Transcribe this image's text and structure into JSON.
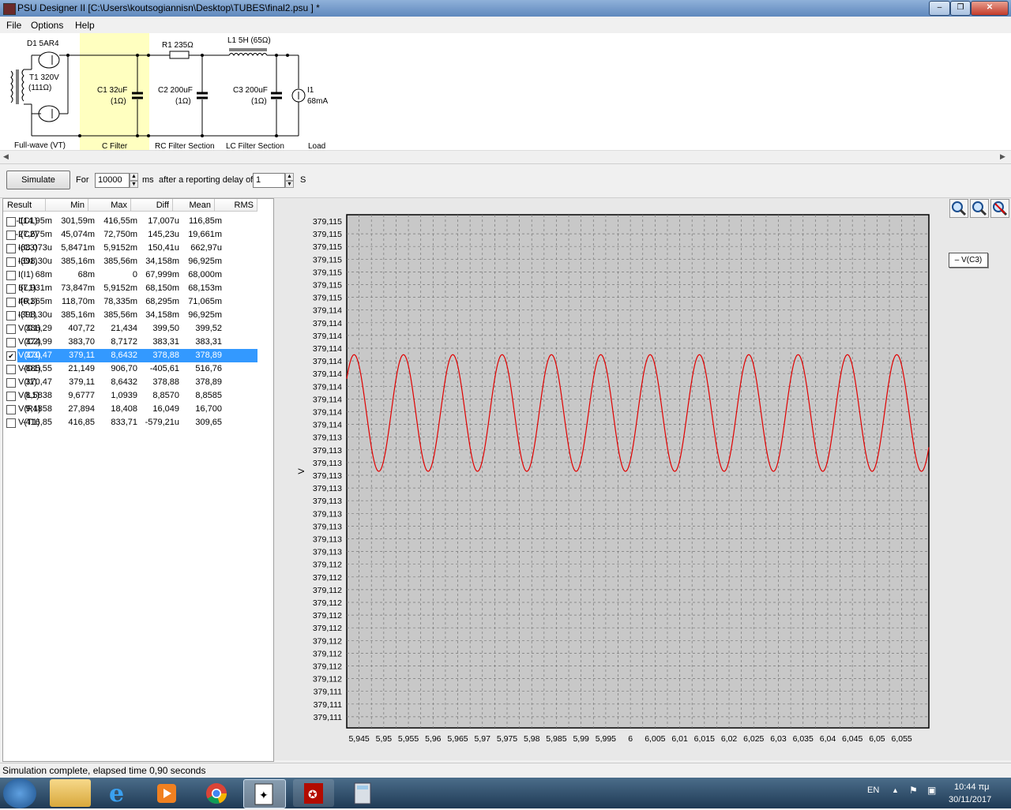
{
  "window": {
    "title": "PSU Designer II  [C:\\Users\\koutsogiannisn\\Desktop\\TUBES\\final2.psu ] *",
    "minimize": "–",
    "maximize": "❐",
    "close": "✕"
  },
  "menu": [
    "File",
    "Options",
    "Help"
  ],
  "schematic": {
    "d1": "D1 5AR4",
    "t1": "T1 320V",
    "t1r": "(111Ω)",
    "c1": "C1 32uF",
    "c1r": "(1Ω)",
    "r1": "R1 235Ω",
    "c2": "C2 200uF",
    "c2r": "(1Ω)",
    "l1": "L1 5H (65Ω)",
    "c3": "C3 200uF",
    "c3r": "(1Ω)",
    "i1": "I1",
    "i1v": "68mA",
    "sections": [
      "Full-wave (VT)",
      "C Filter",
      "RC Filter Section",
      "LC Filter Section",
      "Load"
    ]
  },
  "sim": {
    "button": "Simulate",
    "for_label": "For",
    "duration": "10000",
    "ms_label": "ms",
    "delay_label": "after a reporting delay of",
    "delay": "1",
    "s_label": "S"
  },
  "results": {
    "headers": [
      "Result",
      "Min",
      "Max",
      "Diff",
      "Mean",
      "RMS"
    ],
    "rows": [
      {
        "name": "I(C1)",
        "min": "-114,95m",
        "max": "301,59m",
        "diff": "416,55m",
        "mean": "17,007u",
        "rms": "116,85m",
        "checked": false,
        "selected": false
      },
      {
        "name": "I(C2)",
        "min": "-27,675m",
        "max": "45,074m",
        "diff": "72,750m",
        "mean": "145,23u",
        "rms": "19,661m",
        "checked": false,
        "selected": false
      },
      {
        "name": "I(C3)",
        "min": "-68,073u",
        "max": "5,8471m",
        "diff": "5,9152m",
        "mean": "150,41u",
        "rms": "662,97u",
        "checked": false,
        "selected": false
      },
      {
        "name": "I(D1)",
        "min": "-398,30u",
        "max": "385,16m",
        "diff": "385,56m",
        "mean": "34,158m",
        "rms": "96,925m",
        "checked": false,
        "selected": false
      },
      {
        "name": "I(I1)",
        "min": "68m",
        "max": "68m",
        "diff": "0",
        "mean": "67,999m",
        "rms": "68,000m",
        "checked": false,
        "selected": false
      },
      {
        "name": "I(L1)",
        "min": "67,931m",
        "max": "73,847m",
        "diff": "5,9152m",
        "mean": "68,150m",
        "rms": "68,153m",
        "checked": false,
        "selected": false
      },
      {
        "name": "I(R1)",
        "min": "40,365m",
        "max": "118,70m",
        "diff": "78,335m",
        "mean": "68,295m",
        "rms": "71,065m",
        "checked": false,
        "selected": false
      },
      {
        "name": "I(T1)",
        "min": "-398,30u",
        "max": "385,16m",
        "diff": "385,56m",
        "mean": "34,158m",
        "rms": "96,925m",
        "checked": false,
        "selected": false
      },
      {
        "name": "V(C1)",
        "min": "386,29",
        "max": "407,72",
        "diff": "21,434",
        "mean": "399,50",
        "rms": "399,52",
        "checked": false,
        "selected": false
      },
      {
        "name": "V(C2)",
        "min": "374,99",
        "max": "383,70",
        "diff": "8,7172",
        "mean": "383,31",
        "rms": "383,31",
        "checked": false,
        "selected": false
      },
      {
        "name": "V(C3)",
        "min": "370,47",
        "max": "379,11",
        "diff": "8,6432",
        "mean": "378,88",
        "rms": "378,89",
        "checked": true,
        "selected": true
      },
      {
        "name": "V(D1)",
        "min": "-885,55",
        "max": "21,149",
        "diff": "906,70",
        "mean": "-405,61",
        "rms": "516,76",
        "checked": false,
        "selected": false
      },
      {
        "name": "V(I1)",
        "min": "370,47",
        "max": "379,11",
        "diff": "8,6432",
        "mean": "378,88",
        "rms": "378,89",
        "checked": false,
        "selected": false
      },
      {
        "name": "V(L1)",
        "min": "8,5838",
        "max": "9,6777",
        "diff": "1,0939",
        "mean": "8,8570",
        "rms": "8,8585",
        "checked": false,
        "selected": false
      },
      {
        "name": "V(R1)",
        "min": "9,4858",
        "max": "27,894",
        "diff": "18,408",
        "mean": "16,049",
        "rms": "16,700",
        "checked": false,
        "selected": false
      },
      {
        "name": "V(T1)",
        "min": "-416,85",
        "max": "416,85",
        "diff": "833,71",
        "mean": "-579,21u",
        "rms": "309,65",
        "checked": false,
        "selected": false
      }
    ]
  },
  "legend": "– V(C3)",
  "chart_data": {
    "type": "line",
    "title": "",
    "xlabel": "",
    "ylabel": "V",
    "grid": true,
    "legend": "top-right",
    "y_tick_labels": [
      "379,115",
      "379,115",
      "379,115",
      "379,115",
      "379,115",
      "379,115",
      "379,115",
      "379,114",
      "379,114",
      "379,114",
      "379,114",
      "379,114",
      "379,114",
      "379,114",
      "379,114",
      "379,114",
      "379,114",
      "379,113",
      "379,113",
      "379,113",
      "379,113",
      "379,113",
      "379,113",
      "379,113",
      "379,113",
      "379,113",
      "379,113",
      "379,112",
      "379,112",
      "379,112",
      "379,112",
      "379,112",
      "379,112",
      "379,112",
      "379,112",
      "379,112",
      "379,112",
      "379,111",
      "379,111",
      "379,111"
    ],
    "x_tick_labels": [
      "5,945",
      "5,95",
      "5,955",
      "5,96",
      "5,965",
      "5,97",
      "5,975",
      "5,98",
      "5,985",
      "5,99",
      "5,995",
      "6",
      "6,005",
      "6,01",
      "6,015",
      "6,02",
      "6,025",
      "6,03",
      "6,035",
      "6,04",
      "6,045",
      "6,05",
      "6,055"
    ],
    "xlim": [
      5.9425,
      6.0605
    ],
    "ylim": [
      379.1108,
      379.1152
    ],
    "series": [
      {
        "name": "V(C3)",
        "color": "#e00000",
        "waveform": "sine",
        "frequency_hz": 100,
        "center": 379.1135,
        "amplitude": 0.0005,
        "phase_x": 5.944
      }
    ]
  },
  "status": "Simulation complete, elapsed time 0,90 seconds",
  "tray": {
    "lang": "EN",
    "time": "10:44 πμ",
    "date": "30/11/2017"
  }
}
